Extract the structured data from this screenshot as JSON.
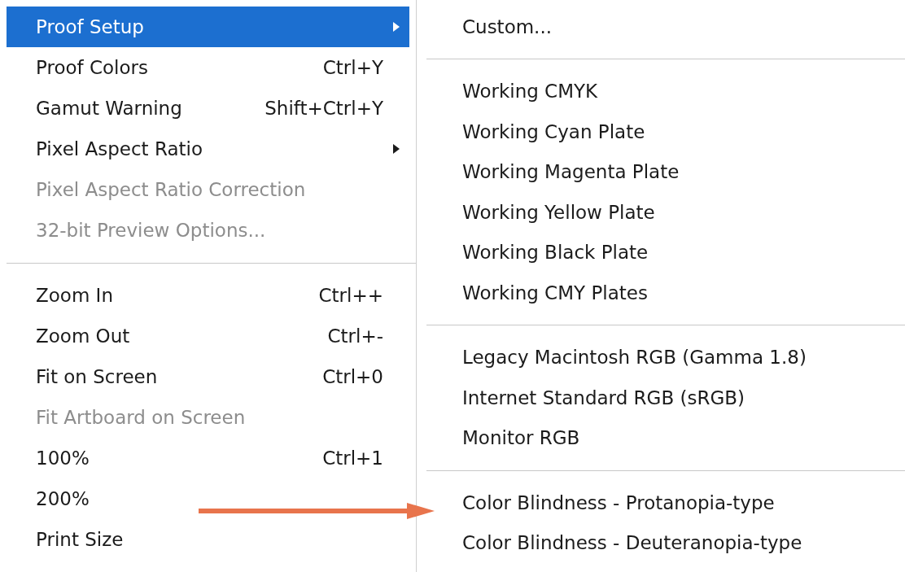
{
  "menu": {
    "items": [
      {
        "kind": "item",
        "label": "Proof Setup",
        "selected": true,
        "disabled": false,
        "submenu": true
      },
      {
        "kind": "item",
        "label": "Proof Colors",
        "shortcut": "Ctrl+Y",
        "selected": false,
        "disabled": false,
        "submenu": false
      },
      {
        "kind": "item",
        "label": "Gamut Warning",
        "shortcut": "Shift+Ctrl+Y",
        "selected": false,
        "disabled": false,
        "submenu": false
      },
      {
        "kind": "item",
        "label": "Pixel Aspect Ratio",
        "selected": false,
        "disabled": false,
        "submenu": true
      },
      {
        "kind": "item",
        "label": "Pixel Aspect Ratio Correction",
        "selected": false,
        "disabled": true,
        "submenu": false
      },
      {
        "kind": "item",
        "label": "32-bit Preview Options...",
        "selected": false,
        "disabled": true,
        "submenu": false
      },
      {
        "kind": "separator"
      },
      {
        "kind": "item",
        "label": "Zoom In",
        "shortcut": "Ctrl++",
        "selected": false,
        "disabled": false,
        "submenu": false
      },
      {
        "kind": "item",
        "label": "Zoom Out",
        "shortcut": "Ctrl+-",
        "selected": false,
        "disabled": false,
        "submenu": false
      },
      {
        "kind": "item",
        "label": "Fit on Screen",
        "shortcut": "Ctrl+0",
        "selected": false,
        "disabled": false,
        "submenu": false
      },
      {
        "kind": "item",
        "label": "Fit Artboard on Screen",
        "selected": false,
        "disabled": true,
        "submenu": false
      },
      {
        "kind": "item",
        "label": "100%",
        "shortcut": "Ctrl+1",
        "selected": false,
        "disabled": false,
        "submenu": false
      },
      {
        "kind": "item",
        "label": "200%",
        "selected": false,
        "disabled": false,
        "submenu": false
      },
      {
        "kind": "item",
        "label": "Print Size",
        "selected": false,
        "disabled": false,
        "submenu": false
      }
    ]
  },
  "submenu": {
    "items": [
      {
        "kind": "item",
        "label": "Custom..."
      },
      {
        "kind": "separator"
      },
      {
        "kind": "item",
        "label": "Working CMYK"
      },
      {
        "kind": "item",
        "label": "Working Cyan Plate"
      },
      {
        "kind": "item",
        "label": "Working Magenta Plate"
      },
      {
        "kind": "item",
        "label": "Working Yellow Plate"
      },
      {
        "kind": "item",
        "label": "Working Black Plate"
      },
      {
        "kind": "item",
        "label": "Working CMY Plates"
      },
      {
        "kind": "separator"
      },
      {
        "kind": "item",
        "label": "Legacy Macintosh RGB (Gamma 1.8)"
      },
      {
        "kind": "item",
        "label": "Internet Standard RGB (sRGB)"
      },
      {
        "kind": "item",
        "label": "Monitor RGB"
      },
      {
        "kind": "separator"
      },
      {
        "kind": "item",
        "label": "Color Blindness - Protanopia-type"
      },
      {
        "kind": "item",
        "label": "Color Blindness - Deuteranopia-type"
      }
    ]
  }
}
